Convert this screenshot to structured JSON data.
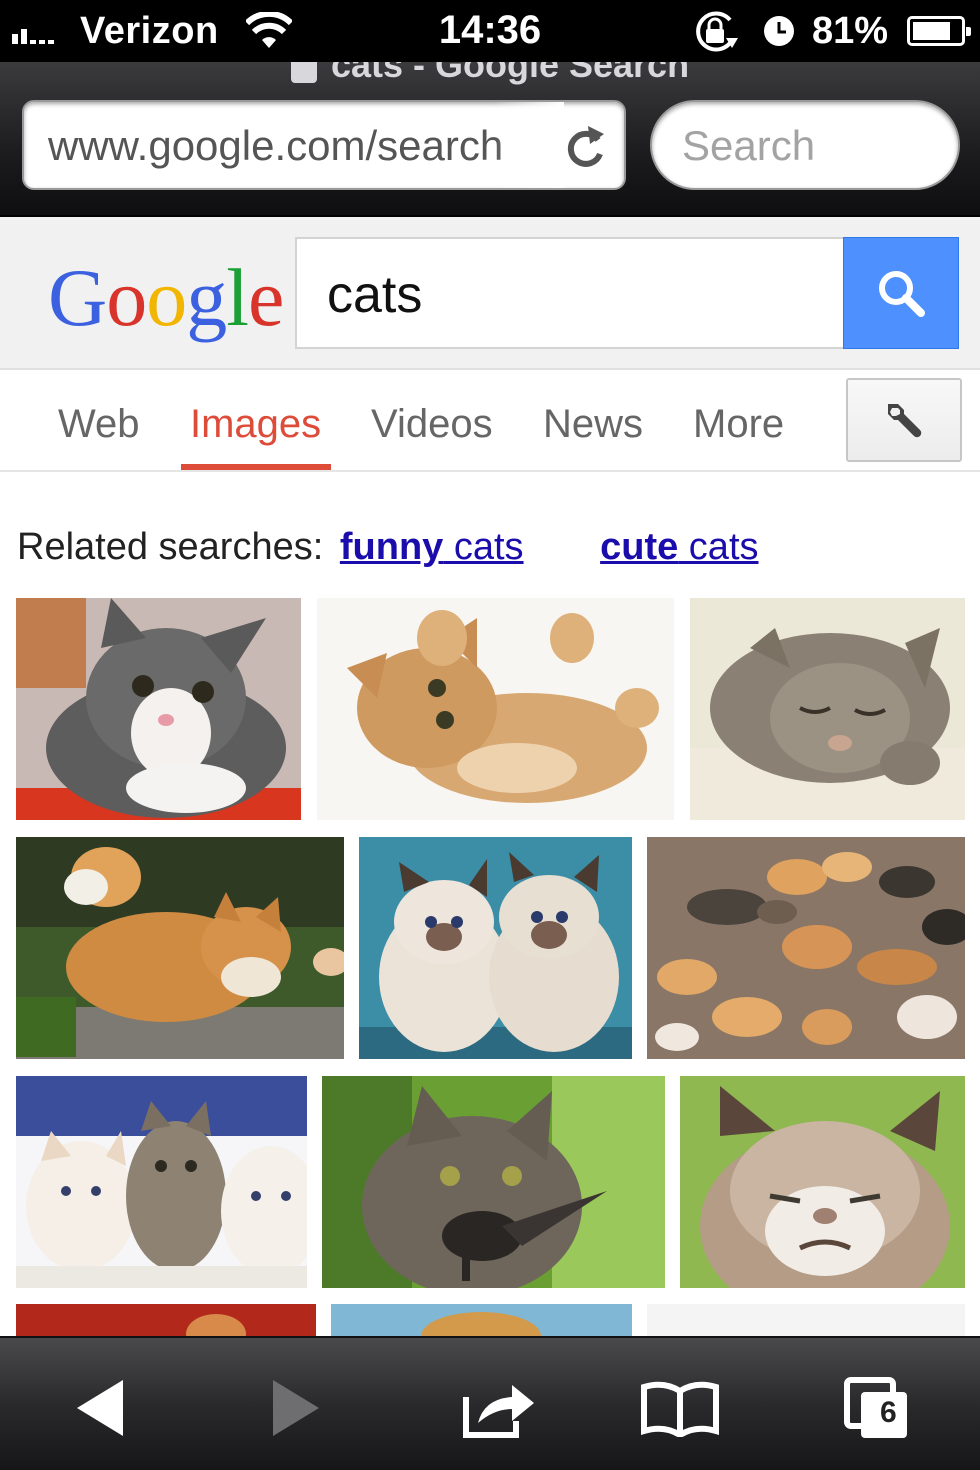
{
  "status": {
    "carrier": "Verizon",
    "time": "14:36",
    "battery_pct_text": "81%",
    "battery_level": 0.81,
    "icons": [
      "signal-bars-icon",
      "wifi-icon",
      "rotation-lock-icon",
      "alarm-icon",
      "battery-icon"
    ]
  },
  "browser": {
    "page_title": "cats - Google Search",
    "url": "www.google.com/search",
    "search_placeholder": "Search",
    "open_tabs": "6"
  },
  "google": {
    "logo": [
      "G",
      "o",
      "o",
      "g",
      "l",
      "e"
    ],
    "logo_colors": [
      "#3c61e0",
      "#d8342b",
      "#f2b600",
      "#3c61e0",
      "#1aa035",
      "#d8342b"
    ],
    "query": "cats",
    "accent": "#4d90fe"
  },
  "tabs": [
    {
      "label": "Web",
      "active": false
    },
    {
      "label": "Images",
      "active": true
    },
    {
      "label": "Videos",
      "active": false
    },
    {
      "label": "News",
      "active": false
    },
    {
      "label": "More",
      "active": false
    }
  ],
  "related": {
    "prefix": "Related searches:",
    "links": [
      {
        "bold": "funny",
        "rest": " cats"
      },
      {
        "bold": "cute",
        "rest": " cats"
      }
    ]
  },
  "colors": {
    "active_tab": "#dd4b39",
    "link": "#1a0dab"
  }
}
